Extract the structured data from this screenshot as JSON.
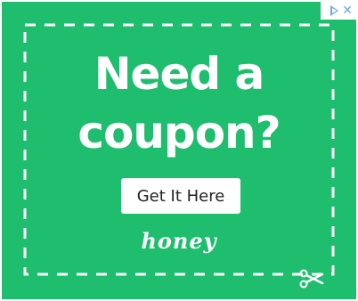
{
  "ad": {
    "headline_line1": "Need a",
    "headline_line2": "coupon?",
    "cta_label": "Get It Here",
    "brand_logo": "honey",
    "background_color": "#1fbe6e",
    "ad_choices": {
      "icons": [
        "adchoices-play-icon",
        "close-icon"
      ]
    },
    "decor_icon": "scissors-icon"
  }
}
